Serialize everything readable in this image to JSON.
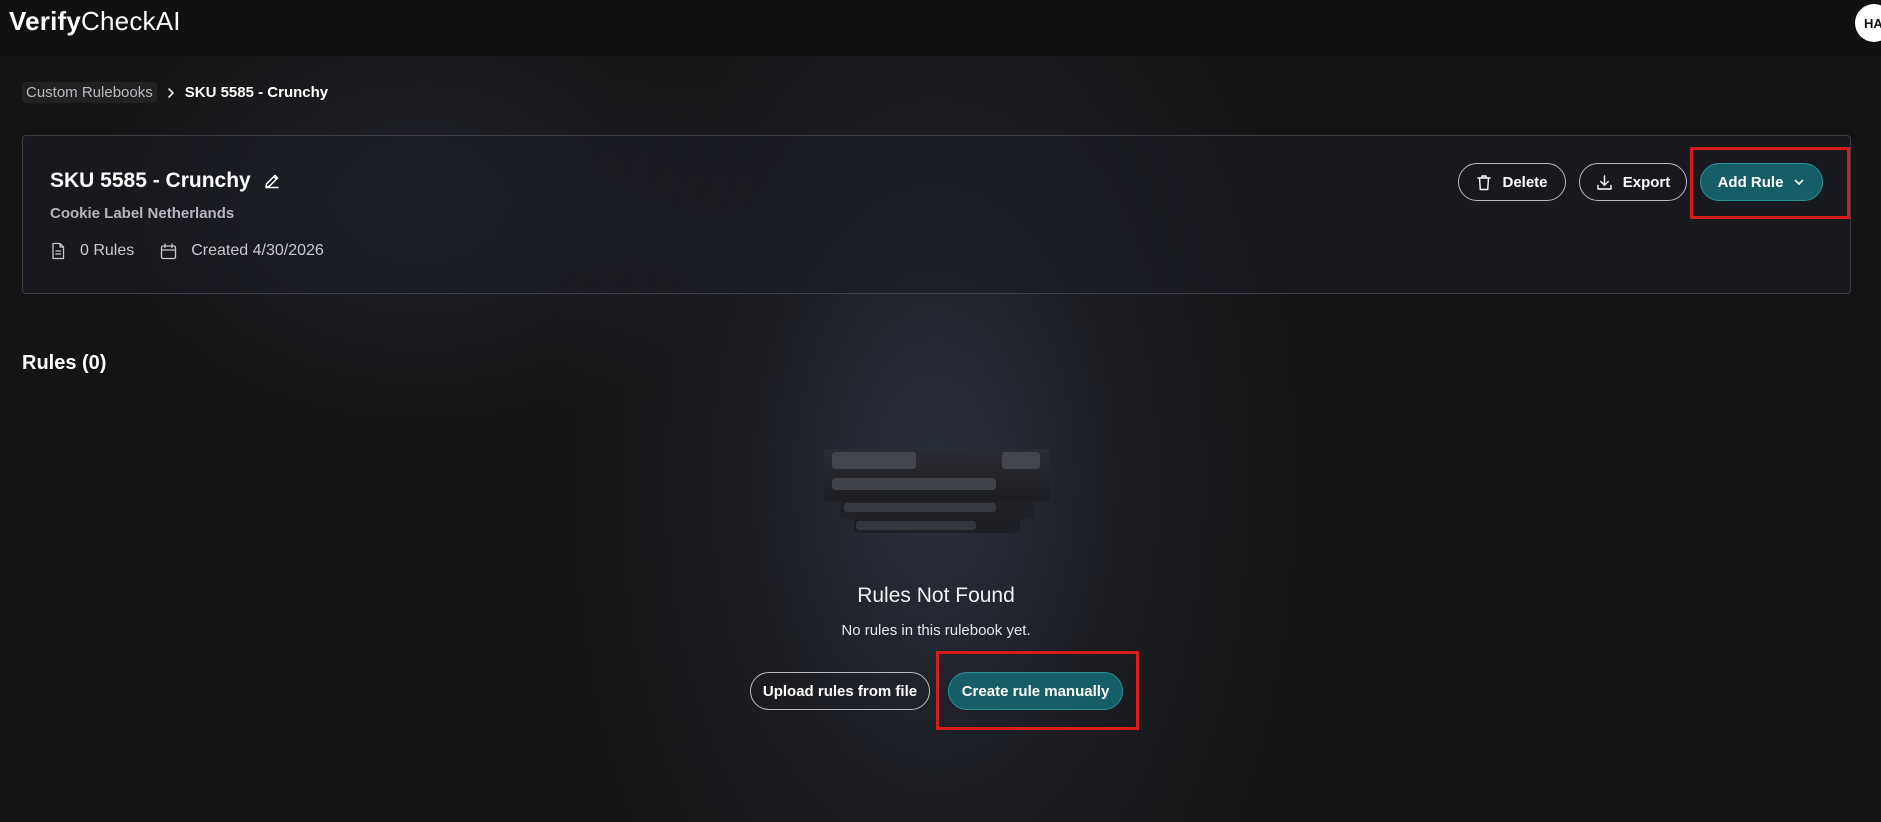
{
  "app": {
    "logo_bold": "Verify",
    "logo_light": "CheckAI",
    "avatar_initials": "HA"
  },
  "breadcrumb": {
    "parent": "Custom Rulebooks",
    "current": "SKU 5585 - Crunchy"
  },
  "rulebook": {
    "title": "SKU 5585 - Crunchy",
    "subtitle": "Cookie Label Netherlands",
    "rules_count": "0 Rules",
    "created": "Created 4/30/2026"
  },
  "actions": {
    "delete_label": "Delete",
    "export_label": "Export",
    "add_rule_label": "Add Rule"
  },
  "rules_section": {
    "title": "Rules (0)"
  },
  "empty_state": {
    "title": "Rules Not Found",
    "message": "No rules in this rulebook yet.",
    "upload_label": "Upload rules from file",
    "create_label": "Create rule manually"
  },
  "colors": {
    "background": "#141414",
    "accent_teal": "#155e66",
    "highlight_red": "#d61c1c"
  },
  "icons": [
    "pencil-icon",
    "document-icon",
    "calendar-icon",
    "trash-icon",
    "download-icon",
    "chevron-down-icon",
    "chevron-right-icon"
  ]
}
